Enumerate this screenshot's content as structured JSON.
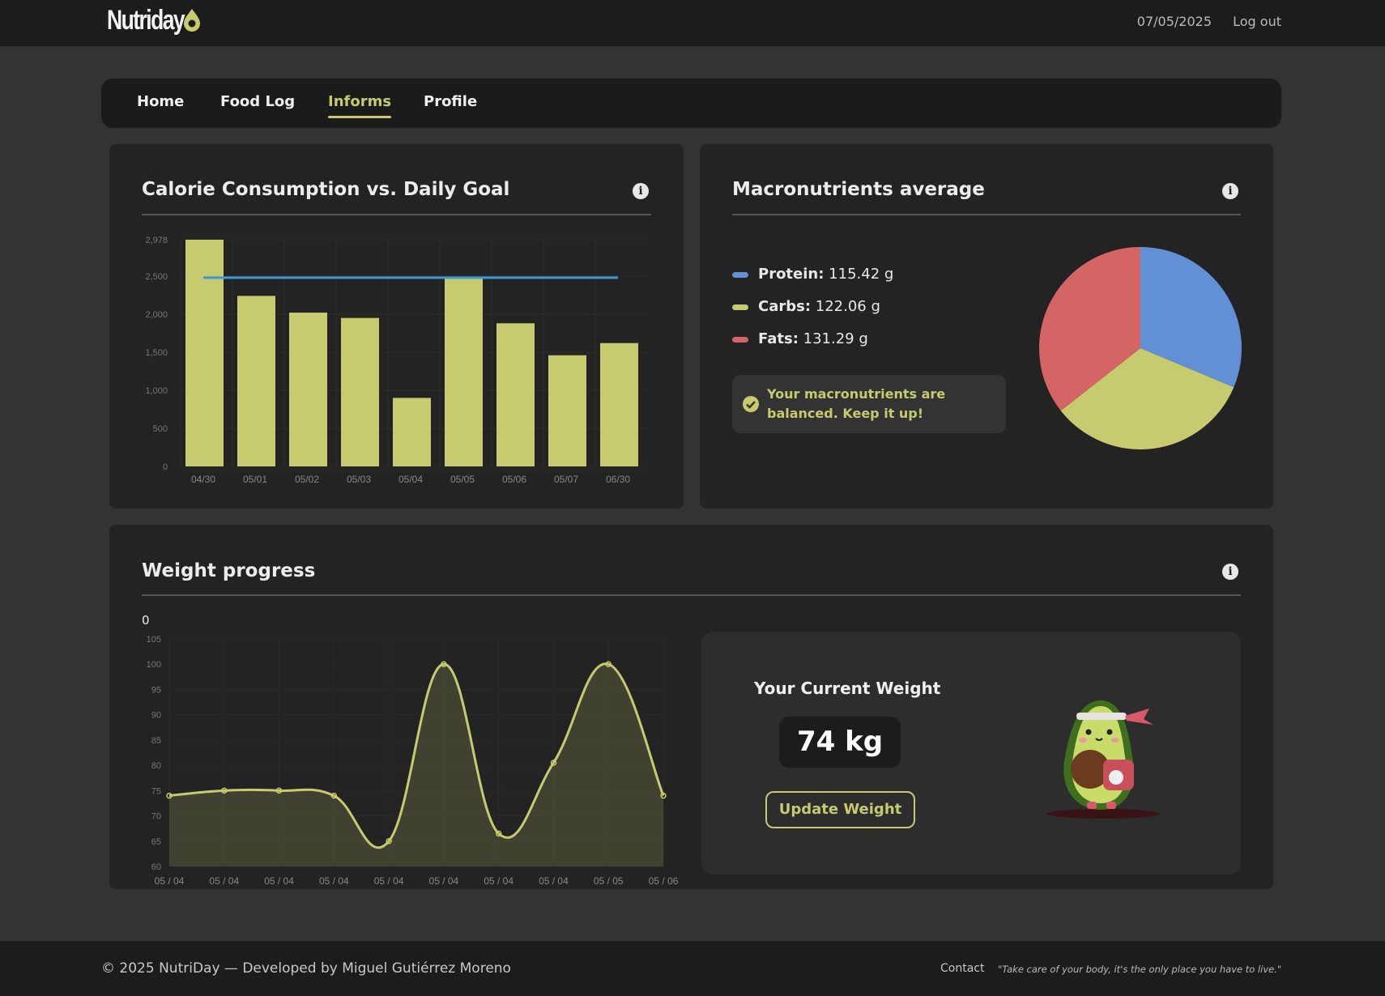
{
  "header": {
    "logo": "Nutriday",
    "date": "07/05/2025",
    "logout": "Log out"
  },
  "nav": {
    "items": [
      "Home",
      "Food Log",
      "Informs",
      "Profile"
    ],
    "active": "Informs"
  },
  "calorie_card": {
    "title": "Calorie Consumption vs. Daily Goal",
    "info_icon": "info-icon"
  },
  "macro_card": {
    "title": "Macronutrients average",
    "info_icon": "info-icon",
    "items": [
      {
        "label": "Protein:",
        "value": "115.42 g",
        "color": "#6190d4"
      },
      {
        "label": "Carbs:",
        "value": "122.06 g",
        "color": "#c5cb6e"
      },
      {
        "label": "Fats:",
        "value": "131.29 g",
        "color": "#d56464"
      }
    ],
    "message": "Your macronutrients are balanced. Keep it up!"
  },
  "weight_card": {
    "title": "Weight progress",
    "info_icon": "info-icon",
    "legend_value": "0",
    "current_label": "Your Current Weight",
    "current_value": "74 kg",
    "update_button": "Update Weight"
  },
  "footer": {
    "copyright": "© 2025 NutriDay — Developed by Miguel Gutiérrez Moreno",
    "contact": "Contact",
    "quote": "\"Take care of your body, it's the only place you have to live.\""
  },
  "colors": {
    "accent": "#c5cb6e",
    "goal_line": "#3a9ad9",
    "background": "#333333",
    "card": "#232323"
  },
  "chart_data": [
    {
      "type": "bar",
      "categories": [
        "04/30",
        "05/01",
        "05/02",
        "05/03",
        "05/04",
        "05/05",
        "05/06",
        "05/07",
        "06/30"
      ],
      "values": [
        2978,
        2240,
        2020,
        1950,
        900,
        2470,
        1880,
        1460,
        1620
      ],
      "goal_line": 2480,
      "ylim": [
        0,
        2978
      ],
      "yticks": [
        "0",
        "500",
        "1,000",
        "1,500",
        "2,000",
        "2,500",
        "2,978"
      ],
      "grid": true
    },
    {
      "type": "pie",
      "categories": [
        "Protein",
        "Carbs",
        "Fats"
      ],
      "values": [
        115.42,
        122.06,
        131.29
      ],
      "colors": [
        "#6190d4",
        "#c5cb6e",
        "#d56464"
      ]
    },
    {
      "type": "line",
      "categories": [
        "05 / 04",
        "05 / 04",
        "05 / 04",
        "05 / 04",
        "05 / 04",
        "05 / 04",
        "05 / 04",
        "05 / 04",
        "05 / 05",
        "05 / 06"
      ],
      "values": [
        74,
        75,
        75,
        74,
        65,
        100,
        66.5,
        80.5,
        100,
        74
      ],
      "ylim": [
        60,
        105
      ],
      "yticks": [
        "60",
        "65",
        "70",
        "75",
        "80",
        "85",
        "90",
        "95",
        "100",
        "105"
      ],
      "fill": true,
      "grid": true
    }
  ]
}
